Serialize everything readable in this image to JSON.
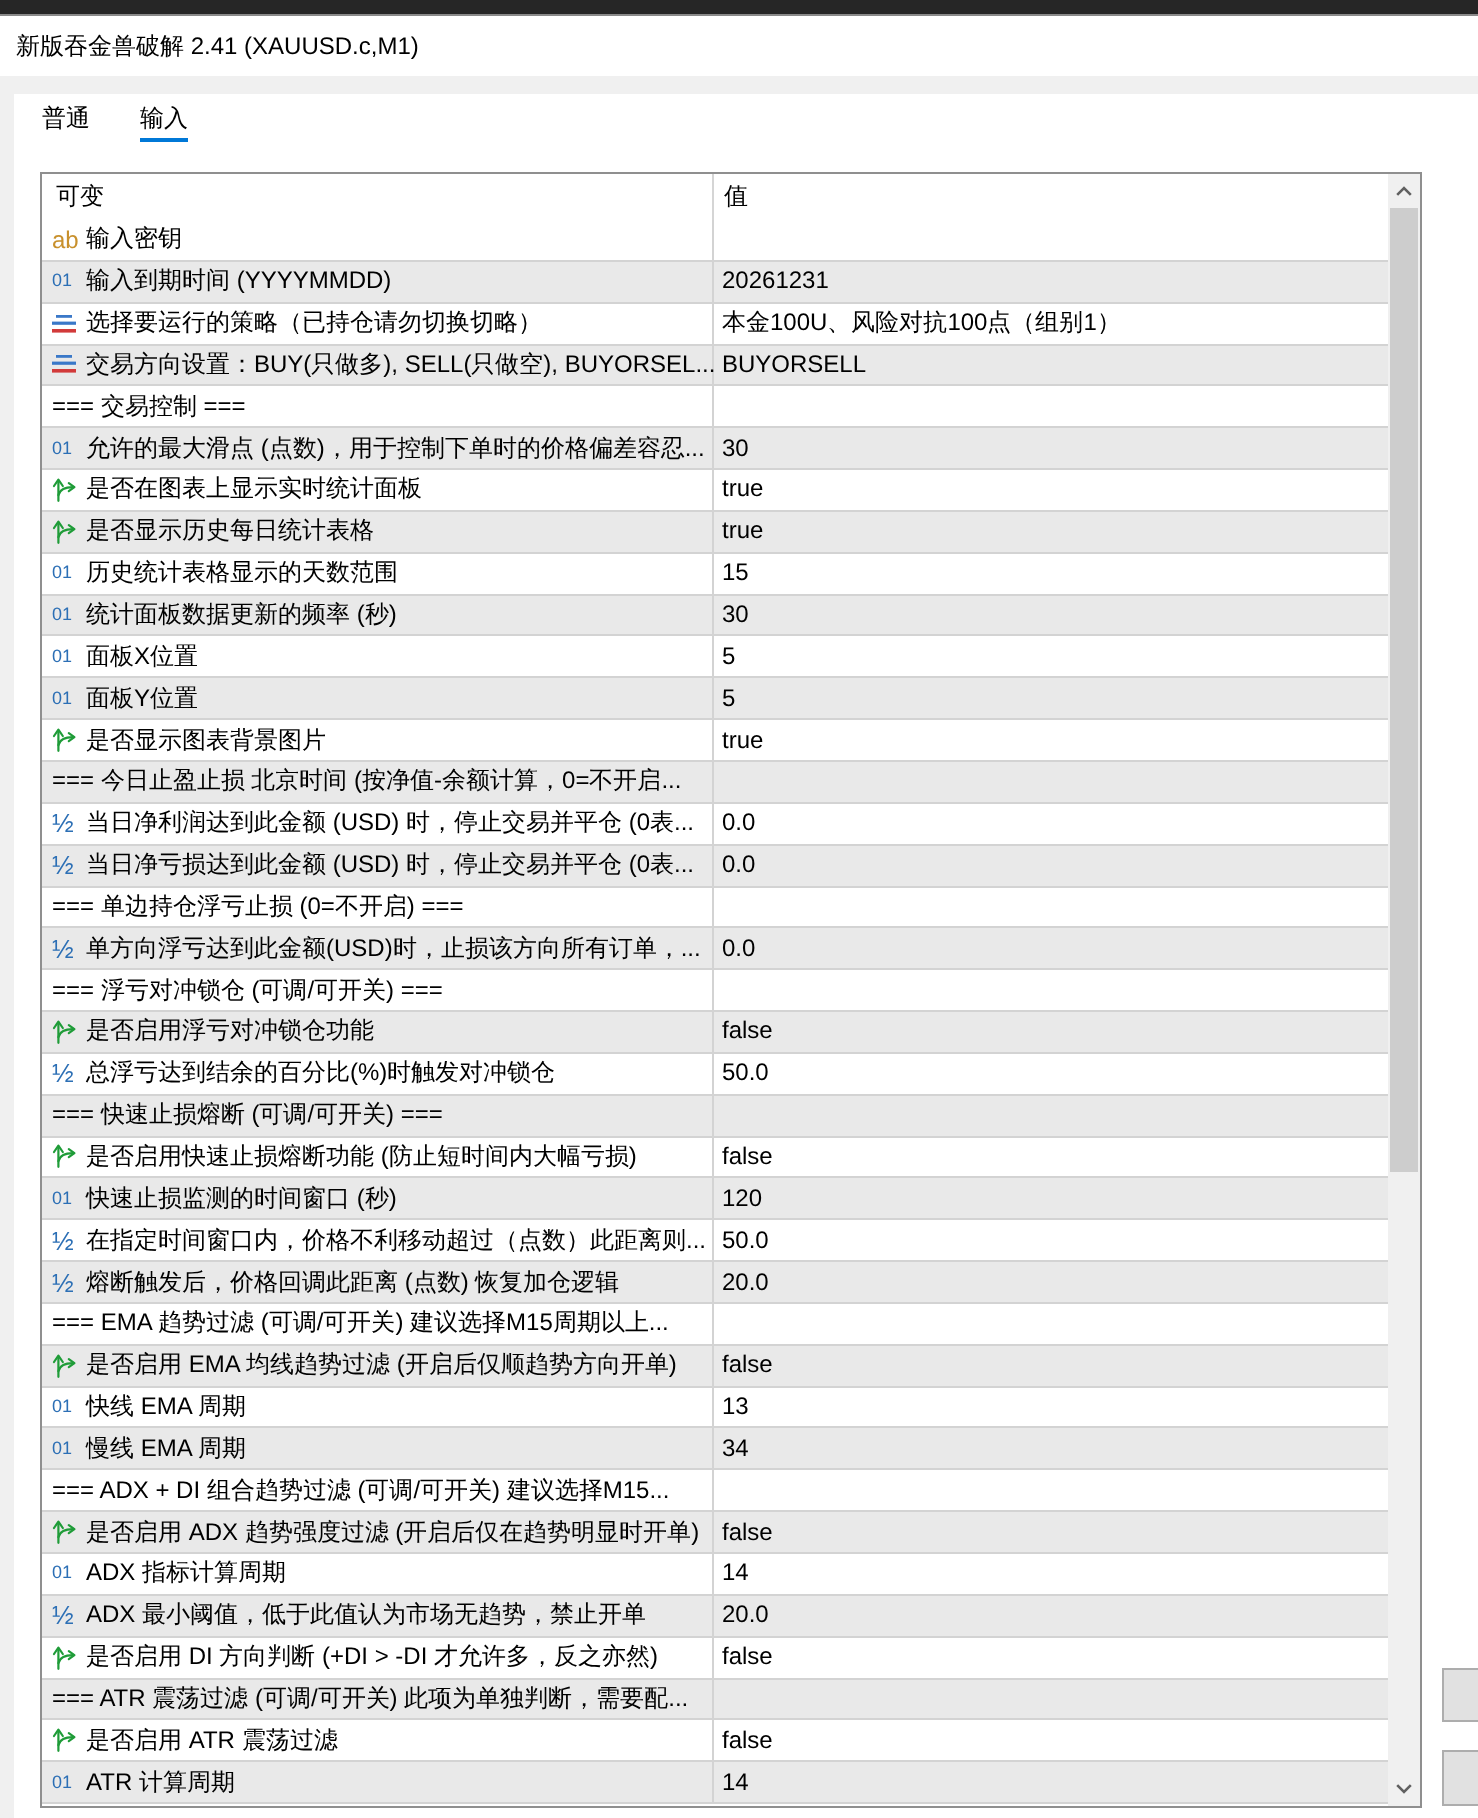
{
  "window": {
    "title": "新版吞金兽破解 2.41 (XAUUSD.c,M1)"
  },
  "tabs": [
    {
      "label": "普通",
      "selected": false
    },
    {
      "label": "输入",
      "selected": true
    }
  ],
  "table": {
    "columns": [
      "可变",
      "值"
    ],
    "rows": [
      {
        "kind": "string",
        "type_mark": "ab",
        "name": "输入密钥"
      },
      {
        "kind": "int",
        "type_mark": "01",
        "name": "输入到期时间 (YYYYMMDD)",
        "value": "20261231"
      },
      {
        "kind": "enum",
        "name": "选择要运行的策略（已持仓请勿切换切略）",
        "value": "本金100U、风险对抗100点（组别1）"
      },
      {
        "kind": "enum",
        "name": "交易方向设置：BUY(只做多), SELL(只做空), BUYORSEL...",
        "value": "BUYORSELL"
      },
      {
        "kind": "section",
        "name": "=== 交易控制 ==="
      },
      {
        "kind": "int",
        "type_mark": "01",
        "name": "允许的最大滑点 (点数)，用于控制下单时的价格偏差容忍...",
        "value": "30"
      },
      {
        "kind": "bool",
        "name": "是否在图表上显示实时统计面板",
        "value": "true"
      },
      {
        "kind": "bool",
        "name": "是否显示历史每日统计表格",
        "value": "true"
      },
      {
        "kind": "int",
        "type_mark": "01",
        "name": "历史统计表格显示的天数范围",
        "value": "15"
      },
      {
        "kind": "int",
        "type_mark": "01",
        "name": "统计面板数据更新的频率 (秒)",
        "value": "30"
      },
      {
        "kind": "int",
        "type_mark": "01",
        "name": "面板X位置",
        "value": "5"
      },
      {
        "kind": "int",
        "type_mark": "01",
        "name": "面板Y位置",
        "value": "5"
      },
      {
        "kind": "bool",
        "name": "是否显示图表背景图片",
        "value": "true"
      },
      {
        "kind": "section",
        "name": "=== 今日止盈止损 北京时间 (按净值-余额计算，0=不开启..."
      },
      {
        "kind": "double",
        "type_mark": "½",
        "name": "当日净利润达到此金额 (USD) 时，停止交易并平仓 (0表...",
        "value": "0.0"
      },
      {
        "kind": "double",
        "type_mark": "½",
        "name": "当日净亏损达到此金额 (USD) 时，停止交易并平仓 (0表...",
        "value": "0.0"
      },
      {
        "kind": "section",
        "name": "=== 单边持仓浮亏止损 (0=不开启) ==="
      },
      {
        "kind": "double",
        "type_mark": "½",
        "name": "单方向浮亏达到此金额(USD)时，止损该方向所有订单，...",
        "value": "0.0"
      },
      {
        "kind": "section",
        "name": "=== 浮亏对冲锁仓 (可调/可开关) ==="
      },
      {
        "kind": "bool",
        "name": "是否启用浮亏对冲锁仓功能",
        "value": "false"
      },
      {
        "kind": "double",
        "type_mark": "½",
        "name": "总浮亏达到结余的百分比(%)时触发对冲锁仓",
        "value": "50.0"
      },
      {
        "kind": "section",
        "name": "=== 快速止损熔断 (可调/可开关) ==="
      },
      {
        "kind": "bool",
        "name": "是否启用快速止损熔断功能 (防止短时间内大幅亏损)",
        "value": "false"
      },
      {
        "kind": "int",
        "type_mark": "01",
        "name": "快速止损监测的时间窗口 (秒)",
        "value": "120"
      },
      {
        "kind": "double",
        "type_mark": "½",
        "name": "在指定时间窗口内，价格不利移动超过（点数）此距离则...",
        "value": "50.0"
      },
      {
        "kind": "double",
        "type_mark": "½",
        "name": "熔断触发后，价格回调此距离 (点数) 恢复加仓逻辑",
        "value": "20.0"
      },
      {
        "kind": "section",
        "name": "=== EMA 趋势过滤 (可调/可开关) 建议选择M15周期以上..."
      },
      {
        "kind": "bool",
        "name": "是否启用 EMA 均线趋势过滤 (开启后仅顺趋势方向开单)",
        "value": "false"
      },
      {
        "kind": "int",
        "type_mark": "01",
        "name": "快线 EMA 周期",
        "value": "13"
      },
      {
        "kind": "int",
        "type_mark": "01",
        "name": "慢线 EMA 周期",
        "value": "34"
      },
      {
        "kind": "section",
        "name": "=== ADX + DI 组合趋势过滤 (可调/可开关) 建议选择M15..."
      },
      {
        "kind": "bool",
        "name": "是否启用 ADX 趋势强度过滤 (开启后仅在趋势明显时开单)",
        "value": "false"
      },
      {
        "kind": "int",
        "type_mark": "01",
        "name": "ADX 指标计算周期",
        "value": "14"
      },
      {
        "kind": "double",
        "type_mark": "½",
        "name": "ADX 最小阈值，低于此值认为市场无趋势，禁止开单",
        "value": "20.0"
      },
      {
        "kind": "bool",
        "name": "是否启用 DI 方向判断 (+DI > -DI 才允许多，反之亦然)",
        "value": "false"
      },
      {
        "kind": "section",
        "name": "=== ATR 震荡过滤 (可调/可开关) 此项为单独判断，需要配..."
      },
      {
        "kind": "bool",
        "name": "是否启用 ATR 震荡过滤",
        "value": "false"
      },
      {
        "kind": "int",
        "type_mark": "01",
        "name": "ATR 计算周期",
        "value": "14"
      }
    ]
  }
}
